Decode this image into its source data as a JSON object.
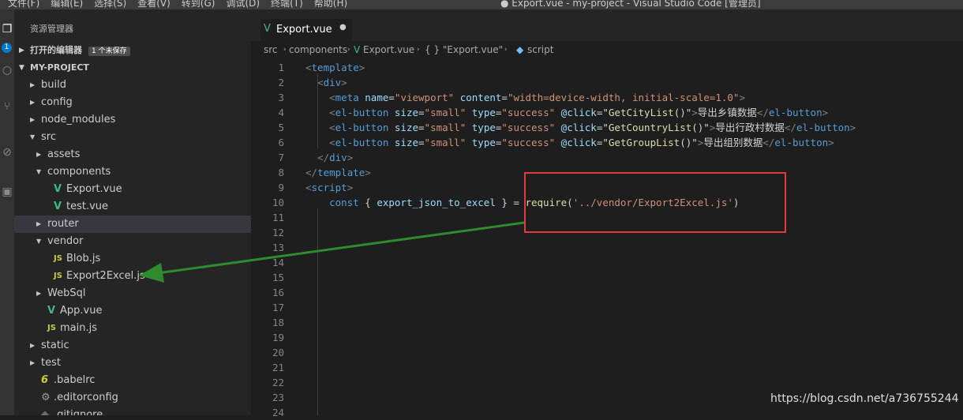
{
  "menubar": {
    "menus": [
      "文件(F)",
      "编辑(E)",
      "选择(S)",
      "查看(V)",
      "转到(G)",
      "调试(D)",
      "终端(T)",
      "帮助(H)"
    ],
    "title": "● Export.vue - my-project - Visual Studio Code [管理员]"
  },
  "activity": {
    "badge": "1"
  },
  "explorer": {
    "title": "资源管理器",
    "open_editors": {
      "label": "打开的编辑器",
      "badge": "1 个未保存"
    },
    "project": {
      "label": "MY-PROJECT"
    },
    "tree": [
      {
        "label": "build",
        "kind": "folder",
        "depth": 0,
        "expanded": false
      },
      {
        "label": "config",
        "kind": "folder",
        "depth": 0,
        "expanded": false
      },
      {
        "label": "node_modules",
        "kind": "folder",
        "depth": 0,
        "expanded": false
      },
      {
        "label": "src",
        "kind": "folder",
        "depth": 0,
        "expanded": true
      },
      {
        "label": "assets",
        "kind": "folder",
        "depth": 1,
        "expanded": false
      },
      {
        "label": "components",
        "kind": "folder",
        "depth": 1,
        "expanded": true
      },
      {
        "label": "Export.vue",
        "kind": "vue",
        "depth": 2
      },
      {
        "label": "test.vue",
        "kind": "vue",
        "depth": 2
      },
      {
        "label": "router",
        "kind": "folder",
        "depth": 1,
        "expanded": false,
        "selected": true
      },
      {
        "label": "vendor",
        "kind": "folder",
        "depth": 1,
        "expanded": true
      },
      {
        "label": "Blob.js",
        "kind": "js",
        "depth": 2
      },
      {
        "label": "Export2Excel.js",
        "kind": "js",
        "depth": 2
      },
      {
        "label": "WebSql",
        "kind": "folder",
        "depth": 1,
        "expanded": false
      },
      {
        "label": "App.vue",
        "kind": "vue",
        "depth": 1
      },
      {
        "label": "main.js",
        "kind": "js",
        "depth": 1
      },
      {
        "label": "static",
        "kind": "folder",
        "depth": 0,
        "expanded": false
      },
      {
        "label": "test",
        "kind": "folder",
        "depth": 0,
        "expanded": false
      },
      {
        "label": ".babelrc",
        "kind": "babel",
        "depth": 0
      },
      {
        "label": ".editorconfig",
        "kind": "gear",
        "depth": 0
      },
      {
        "label": ".gitignore",
        "kind": "git",
        "depth": 0
      }
    ]
  },
  "editor": {
    "tab": {
      "label": "Export.vue",
      "modified": "●"
    },
    "breadcrumb": [
      "src",
      "components",
      "Export.vue",
      "{ } \"Export.vue\"",
      "script"
    ],
    "line_numbers": [
      "1",
      "2",
      "3",
      "4",
      "5",
      "6",
      "7",
      "8",
      "9",
      "10",
      "11",
      "12",
      "13",
      "14",
      "15",
      "16",
      "17",
      "18",
      "19",
      "20",
      "21",
      "22",
      "23",
      "24"
    ],
    "lines": [
      [
        [
          "br",
          "<"
        ],
        [
          "tag",
          "template"
        ],
        [
          "br",
          ">"
        ]
      ],
      [
        [
          "txt",
          "  "
        ],
        [
          "br",
          "<"
        ],
        [
          "tag",
          "div"
        ],
        [
          "br",
          ">"
        ]
      ],
      [
        [
          "txt",
          "    "
        ],
        [
          "br",
          "<"
        ],
        [
          "tag",
          "meta"
        ],
        [
          "txt",
          " "
        ],
        [
          "attr",
          "name"
        ],
        [
          "txt",
          "="
        ],
        [
          "str",
          "\"viewport\""
        ],
        [
          "txt",
          " "
        ],
        [
          "attr",
          "content"
        ],
        [
          "txt",
          "="
        ],
        [
          "str",
          "\"width=device-width, initial-scale=1.0\""
        ],
        [
          "br",
          ">"
        ]
      ],
      [
        [
          "txt",
          "    "
        ],
        [
          "br",
          "<"
        ],
        [
          "tag",
          "el-button"
        ],
        [
          "txt",
          " "
        ],
        [
          "attr",
          "size"
        ],
        [
          "txt",
          "="
        ],
        [
          "str",
          "\"small\""
        ],
        [
          "txt",
          " "
        ],
        [
          "attr",
          "type"
        ],
        [
          "txt",
          "="
        ],
        [
          "str",
          "\"success\""
        ],
        [
          "txt",
          " "
        ],
        [
          "attr",
          "@click"
        ],
        [
          "txt",
          "=\""
        ],
        [
          "fn",
          "GetCityList"
        ],
        [
          "txt",
          "()\""
        ],
        [
          "br",
          ">"
        ],
        [
          "txt",
          "导出乡镇数据"
        ],
        [
          "br",
          "</"
        ],
        [
          "tag",
          "el-button"
        ],
        [
          "br",
          ">"
        ]
      ],
      [
        [
          "txt",
          "    "
        ],
        [
          "br",
          "<"
        ],
        [
          "tag",
          "el-button"
        ],
        [
          "txt",
          " "
        ],
        [
          "attr",
          "size"
        ],
        [
          "txt",
          "="
        ],
        [
          "str",
          "\"small\""
        ],
        [
          "txt",
          " "
        ],
        [
          "attr",
          "type"
        ],
        [
          "txt",
          "="
        ],
        [
          "str",
          "\"success\""
        ],
        [
          "txt",
          " "
        ],
        [
          "attr",
          "@click"
        ],
        [
          "txt",
          "=\""
        ],
        [
          "fn",
          "GetCountryList"
        ],
        [
          "txt",
          "()\""
        ],
        [
          "br",
          ">"
        ],
        [
          "txt",
          "导出行政村数据"
        ],
        [
          "br",
          "</"
        ],
        [
          "tag",
          "el-button"
        ],
        [
          "br",
          ">"
        ]
      ],
      [
        [
          "txt",
          "    "
        ],
        [
          "br",
          "<"
        ],
        [
          "tag",
          "el-button"
        ],
        [
          "txt",
          " "
        ],
        [
          "attr",
          "size"
        ],
        [
          "txt",
          "="
        ],
        [
          "str",
          "\"small\""
        ],
        [
          "txt",
          " "
        ],
        [
          "attr",
          "type"
        ],
        [
          "txt",
          "="
        ],
        [
          "str",
          "\"success\""
        ],
        [
          "txt",
          " "
        ],
        [
          "attr",
          "@click"
        ],
        [
          "txt",
          "=\""
        ],
        [
          "fn",
          "GetGroupList"
        ],
        [
          "txt",
          "()\""
        ],
        [
          "br",
          ">"
        ],
        [
          "txt",
          "导出组别数据"
        ],
        [
          "br",
          "</"
        ],
        [
          "tag",
          "el-button"
        ],
        [
          "br",
          ">"
        ]
      ],
      [
        [
          "txt",
          "  "
        ],
        [
          "br",
          "</"
        ],
        [
          "tag",
          "div"
        ],
        [
          "br",
          ">"
        ]
      ],
      [
        [
          "br",
          "</"
        ],
        [
          "tag",
          "template"
        ],
        [
          "br",
          ">"
        ]
      ],
      [
        [
          "br",
          "<"
        ],
        [
          "tag",
          "script"
        ],
        [
          "br",
          ">"
        ]
      ],
      [
        [
          "txt",
          "    "
        ],
        [
          "kw",
          "const"
        ],
        [
          "txt",
          " { "
        ],
        [
          "var",
          "export_json_to_excel"
        ],
        [
          "txt",
          " } = "
        ],
        [
          "fn",
          "require"
        ],
        [
          "txt",
          "("
        ],
        [
          "str",
          "'../vendor/Export2Excel.js'"
        ],
        [
          "txt",
          ")"
        ]
      ],
      [],
      [],
      [],
      [],
      [],
      [],
      [],
      [],
      [],
      [],
      [],
      [],
      [],
      []
    ]
  },
  "annotation_colors": {
    "box": "#e03c3c",
    "arrow": "#2e8b2e"
  },
  "watermark": "https://blog.csdn.net/a736755244"
}
